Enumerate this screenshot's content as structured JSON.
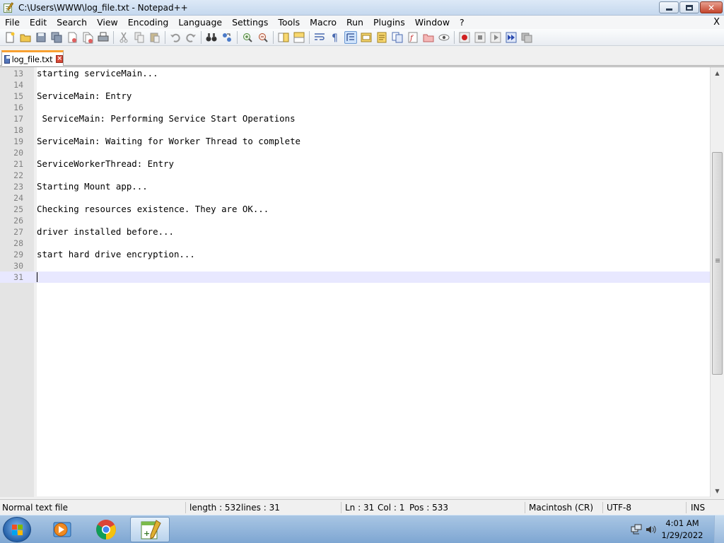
{
  "window": {
    "title": "C:\\Users\\WWW\\log_file.txt - Notepad++",
    "close_glyph": "✕"
  },
  "menu": {
    "items": [
      "File",
      "Edit",
      "Search",
      "View",
      "Encoding",
      "Language",
      "Settings",
      "Tools",
      "Macro",
      "Run",
      "Plugins",
      "Window",
      "?"
    ],
    "close_label": "X"
  },
  "tabs": [
    {
      "label": "log_file.txt",
      "close_glyph": "×"
    }
  ],
  "editor": {
    "lines": [
      {
        "num": "13",
        "text": "starting serviceMain..."
      },
      {
        "num": "14",
        "text": ""
      },
      {
        "num": "15",
        "text": "ServiceMain: Entry"
      },
      {
        "num": "16",
        "text": ""
      },
      {
        "num": "17",
        "text": " ServiceMain: Performing Service Start Operations"
      },
      {
        "num": "18",
        "text": ""
      },
      {
        "num": "19",
        "text": "ServiceMain: Waiting for Worker Thread to complete"
      },
      {
        "num": "20",
        "text": ""
      },
      {
        "num": "21",
        "text": "ServiceWorkerThread: Entry"
      },
      {
        "num": "22",
        "text": ""
      },
      {
        "num": "23",
        "text": "Starting Mount app..."
      },
      {
        "num": "24",
        "text": ""
      },
      {
        "num": "25",
        "text": "Checking resources existence. They are OK..."
      },
      {
        "num": "26",
        "text": ""
      },
      {
        "num": "27",
        "text": "driver installed before..."
      },
      {
        "num": "28",
        "text": ""
      },
      {
        "num": "29",
        "text": "start hard drive encryption..."
      },
      {
        "num": "30",
        "text": ""
      },
      {
        "num": "31",
        "text": ""
      }
    ],
    "current_line": "31"
  },
  "status": {
    "file_type": "Normal text file",
    "length": "length : 532",
    "lines": "lines : 31",
    "ln": "Ln : 31",
    "col": "Col : 1",
    "pos": "Pos : 533",
    "eol": "Macintosh (CR)",
    "encoding": "UTF-8",
    "mode": "INS"
  },
  "taskbar": {
    "time": "4:01 AM",
    "date": "1/29/2022",
    "apps": [
      "windows-media-player-icon",
      "chrome-icon",
      "notepad-plus-plus-icon"
    ]
  },
  "colors": {
    "tab_accent": "#f8a030",
    "current_line_bg": "#e8e8ff",
    "gutter_bg": "#e4e4e4"
  }
}
